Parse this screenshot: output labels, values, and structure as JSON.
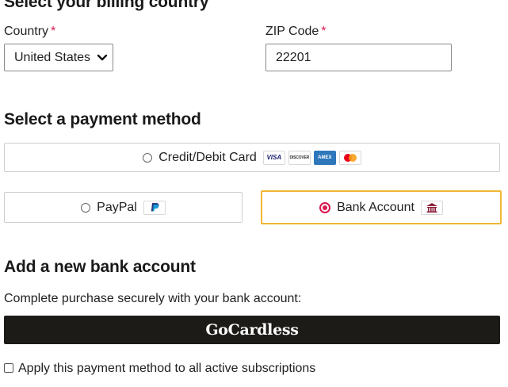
{
  "billing": {
    "heading": "Select your billing country",
    "country_label": "Country",
    "country_value": "United States",
    "zip_label": "ZIP Code",
    "zip_value": "22201",
    "required_mark": "*"
  },
  "payment": {
    "heading": "Select a payment method",
    "credit_label": "Credit/Debit Card",
    "card_logos": {
      "visa": "VISA",
      "discover": "DISCOVER",
      "amex": "AMEX"
    },
    "paypal_label": "PayPal",
    "paypal_badge": "PayPal",
    "bank_label": "Bank Account",
    "selected": "bank"
  },
  "bank": {
    "heading": "Add a new bank account",
    "description": "Complete purchase securely with your bank account:",
    "button_label": "GoCardless",
    "apply_all_label": "Apply this payment method to all active subscriptions"
  },
  "colors": {
    "accent": "#d6194f",
    "selected_border": "#f2b631",
    "button_bg": "#1d1b17"
  }
}
